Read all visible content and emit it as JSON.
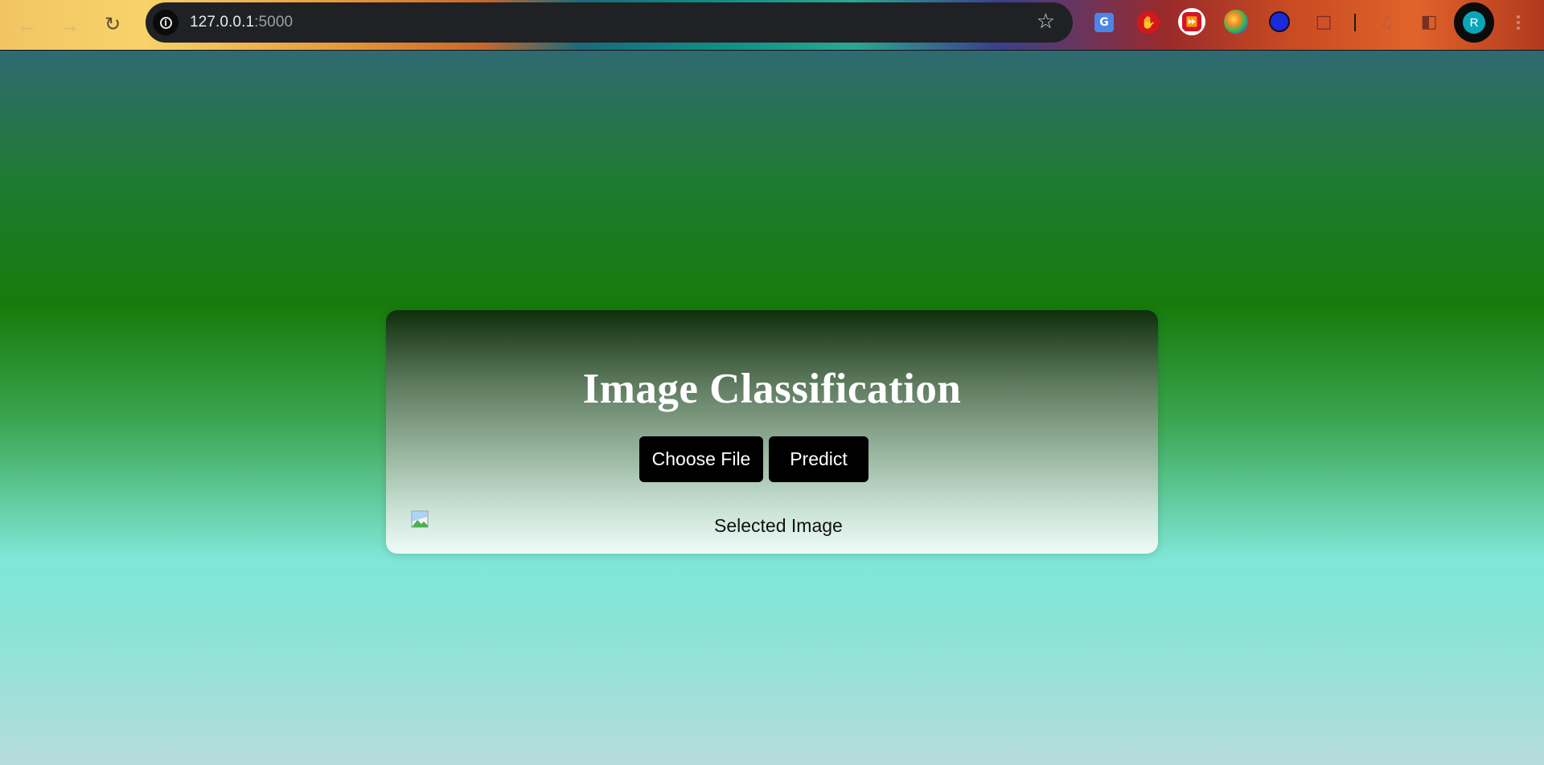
{
  "browser": {
    "url_host": "127.0.0.1",
    "url_port": ":5000",
    "nav": {
      "back_icon": "arrow-left-icon",
      "forward_icon": "arrow-right-icon",
      "reload_icon": "reload-icon"
    },
    "extensions": [
      "google-translate-icon",
      "stop-hand-icon",
      "fast-forward-icon",
      "globe-extension-icon",
      "dark-mode-icon",
      "puzzle-icon",
      "media-controls-icon",
      "side-panel-icon"
    ],
    "profile_initial": "R"
  },
  "page": {
    "title": "Image Classification",
    "choose_file_label": "Choose File",
    "predict_label": "Predict",
    "image_alt": "Selected Image"
  },
  "colors": {
    "button_bg": "#000000",
    "title_color": "#ffffff",
    "omnibox_bg": "#202124",
    "avatar_bg": "#0aa6b8"
  }
}
